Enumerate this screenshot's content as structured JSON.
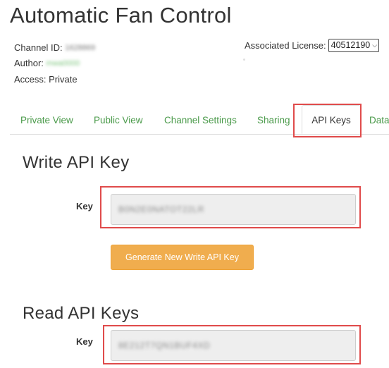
{
  "page": {
    "title": "Automatic Fan Control"
  },
  "channel_info": {
    "channel_id_label": "Channel ID:",
    "channel_id_value": "1628869",
    "author_label": "Author:",
    "author_value": "mwa0000",
    "access_label": "Access:",
    "access_value": "Private"
  },
  "license": {
    "label": "Associated License:",
    "selected": "40512190"
  },
  "tabs": [
    {
      "label": "Private View",
      "active": false
    },
    {
      "label": "Public View",
      "active": false
    },
    {
      "label": "Channel Settings",
      "active": false
    },
    {
      "label": "Sharing",
      "active": false
    },
    {
      "label": "API Keys",
      "active": true
    },
    {
      "label": "Data",
      "active": false
    }
  ],
  "write_api": {
    "heading": "Write API Key",
    "key_label": "Key",
    "key_value": "B0N2E0NATOT22LR",
    "generate_button": "Generate New Write API Key"
  },
  "read_api": {
    "heading": "Read API Keys",
    "key_label": "Key",
    "key_value": "8E212T7QN1BUF4XD"
  },
  "colors": {
    "tab_link": "#4a9a4a",
    "highlight": "#e04b4b",
    "button_warning": "#f0ad4e",
    "field_background": "#eeeeee"
  }
}
